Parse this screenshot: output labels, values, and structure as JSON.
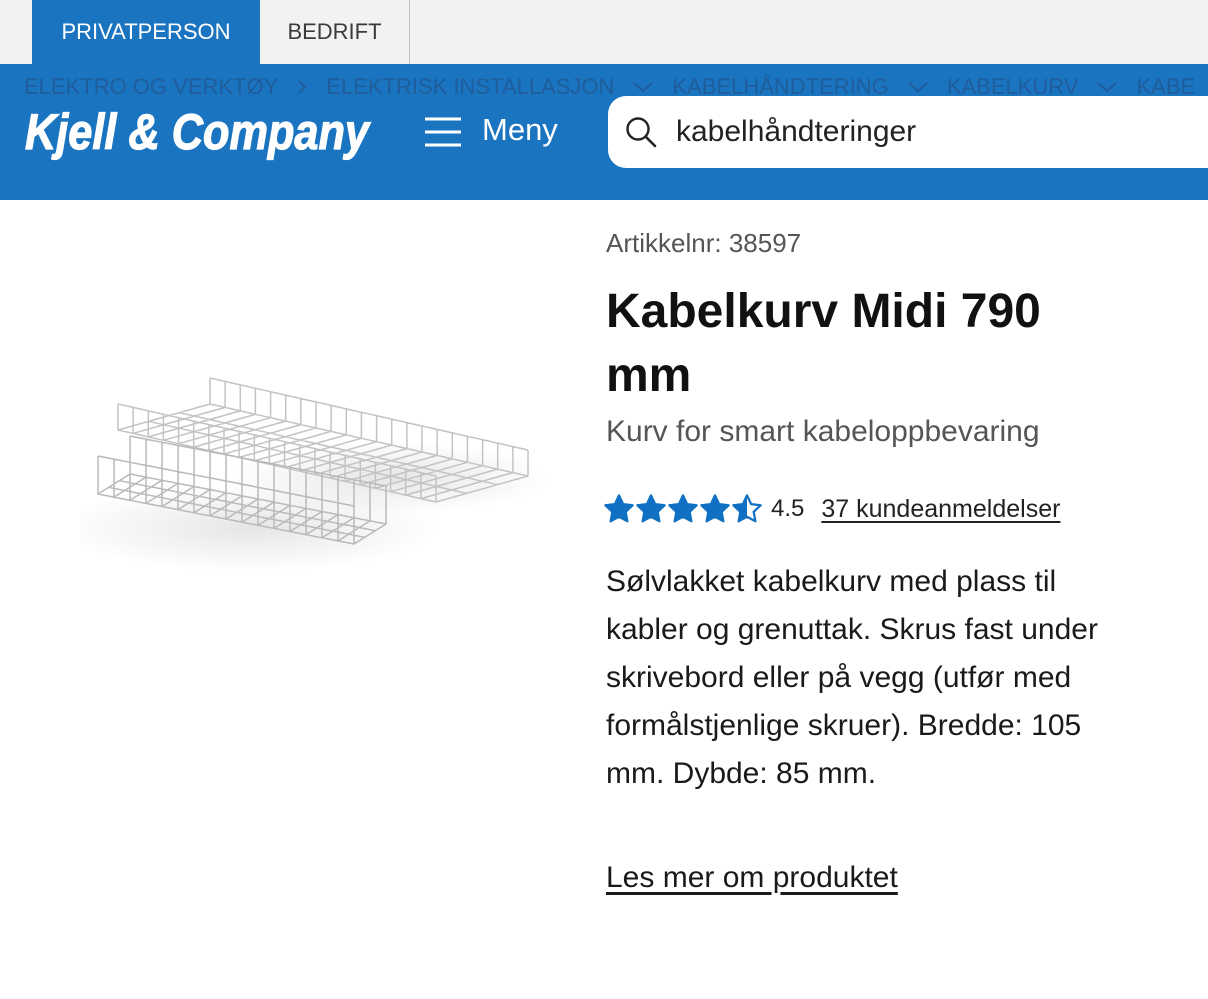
{
  "top_tabs": [
    {
      "label": "PRIVATPERSON",
      "active": true
    },
    {
      "label": "BEDRIFT",
      "active": false
    }
  ],
  "header": {
    "breadcrumb": [
      {
        "label": "ELEKTRO OG VERKTØY",
        "icon": "chevron-right-icon"
      },
      {
        "label": "ELEKTRISK INSTALLASJON",
        "icon": "chevron-down-icon"
      },
      {
        "label": "KABELHÅNDTERING",
        "icon": "chevron-down-icon"
      },
      {
        "label": "KABELKURV",
        "icon": "chevron-down-icon"
      },
      {
        "label": "KABE",
        "icon": null
      }
    ],
    "logo": "Kjell & Company",
    "menu": {
      "label": "Meny",
      "icon": "hamburger-menu-icon"
    },
    "search": {
      "value": "kabelhåndteringer",
      "icon": "search-icon"
    }
  },
  "product": {
    "article_label": "Artikkelnr:",
    "article_number": "38597",
    "title": "Kabelkurv Midi 790 mm",
    "subtitle": "Kurv for smart kabeloppbevaring",
    "rating": {
      "value": 4.5,
      "max": 5,
      "reviews_label": "37 kundeanmeldelser"
    },
    "description": "Sølvlakket kabelkurv med plass til kabler og grenuttak. Skrus fast under skrivebord eller på vegg (utfør med formålstjenlige skruer). Bredde: 105 mm. Dybde: 85 mm.",
    "read_more_label": "Les mer om produktet"
  },
  "colors": {
    "brand_blue": "#1a74c0",
    "breadcrumb_text": "#1f5d9b",
    "top_bar": "#f2f2f2",
    "star": "#1070c4",
    "text": "#1a1a1a",
    "muted_text": "#555555"
  }
}
